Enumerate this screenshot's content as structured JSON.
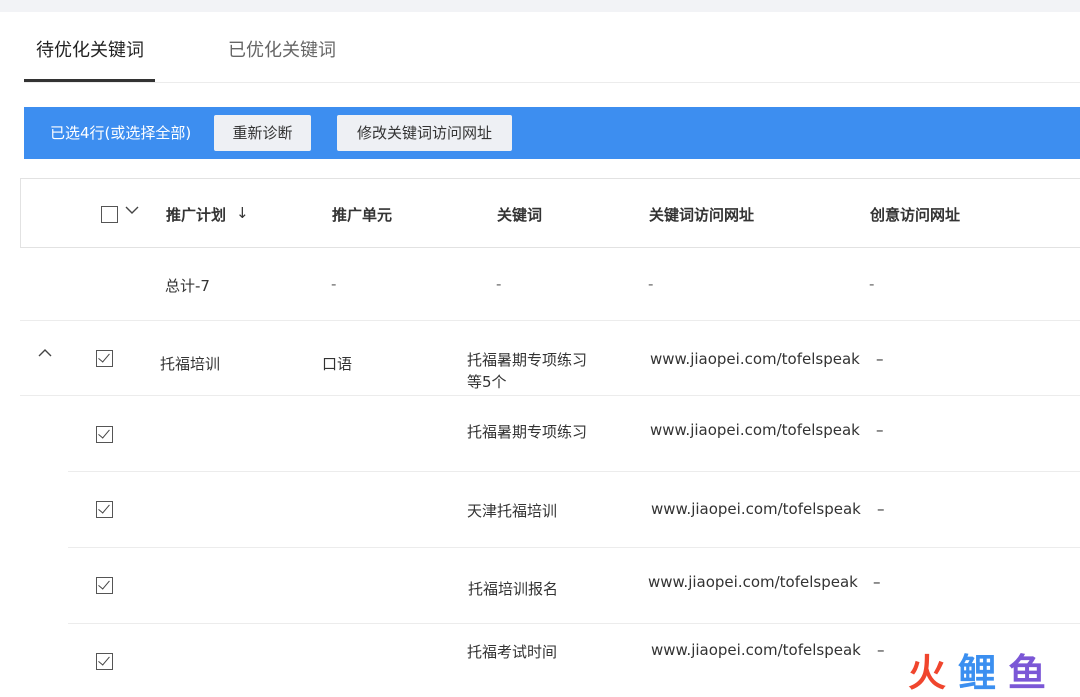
{
  "tabs": [
    {
      "label": "待优化关键词",
      "active": true
    },
    {
      "label": "已优化关键词",
      "active": false
    }
  ],
  "action_bar": {
    "selection_text": "已选4行(或选择全部)",
    "rediagnose_label": "重新诊断",
    "modify_url_label": "修改关键词访问网址",
    "color": "#3d8ef0"
  },
  "table": {
    "headers": {
      "plan": "推广计划",
      "sort_icon": "↓",
      "unit": "推广单元",
      "keyword": "关键词",
      "keyword_url": "关键词访问网址",
      "creative_url": "创意访问网址"
    },
    "total_row": {
      "label": "总计-7",
      "unit": "-",
      "keyword": "-",
      "keyword_url": "-",
      "creative_url": "-"
    },
    "group_row": {
      "plan": "托福培训",
      "unit": "口语",
      "keyword_line1": "托福暑期专项练习",
      "keyword_line2": "等5个",
      "keyword_url": "www.jiaopei.com/tofelspeak",
      "creative_url": "–",
      "checked": true
    },
    "rows": [
      {
        "keyword": "托福暑期专项练习",
        "keyword_url": "www.jiaopei.com/tofelspeak",
        "creative_url": "–",
        "checked": true
      },
      {
        "keyword": "天津托福培训",
        "keyword_url": "www.jiaopei.com/tofelspeak",
        "creative_url": "–",
        "checked": true
      },
      {
        "keyword": "托福培训报名",
        "keyword_url": "www.jiaopei.com/tofelspeak",
        "creative_url": "–",
        "checked": true
      },
      {
        "keyword": "托福考试时间",
        "keyword_url": "www.jiaopei.com/tofelspeak",
        "creative_url": "–",
        "checked": true
      }
    ]
  },
  "watermark": {
    "chars": [
      "火",
      "鲤",
      "鱼"
    ],
    "colors": [
      "#f0452d",
      "#3b8ff0",
      "#7b57d6"
    ]
  }
}
